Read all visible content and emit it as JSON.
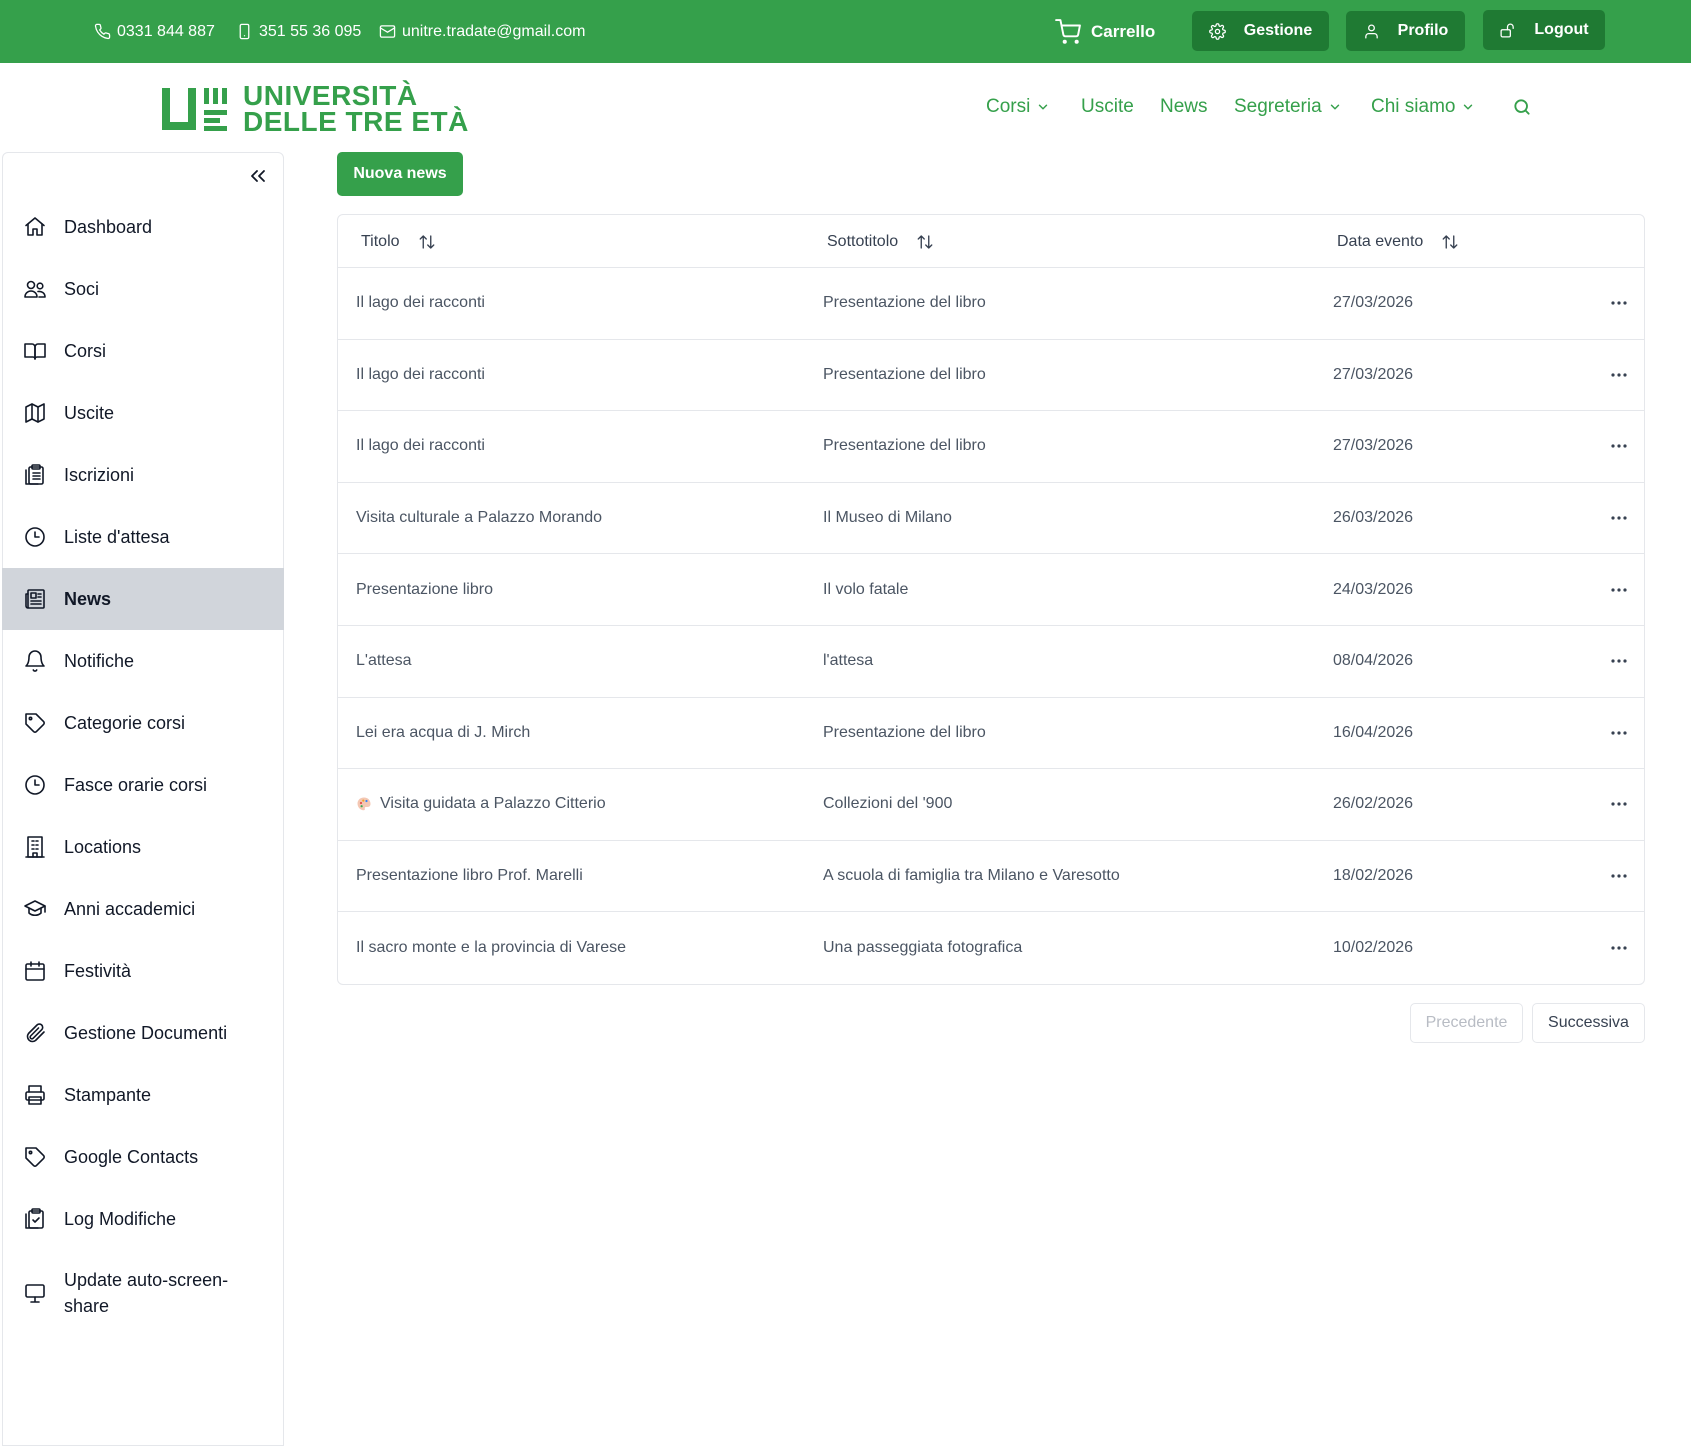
{
  "topbar": {
    "phone": "0331 844 887",
    "mobile": "351 55 36 095",
    "email": "unitre.tradate@gmail.com",
    "cart_label": "Carrello",
    "gestione_label": "Gestione",
    "profilo_label": "Profilo",
    "logout_label": "Logout",
    "bg_color": "#35a04b",
    "button_color": "#1f7a33"
  },
  "header": {
    "logo_line1": "UNIVERSITÀ",
    "logo_line2": "DELLE TRE ETÀ",
    "nav": [
      "Corsi",
      "Uscite",
      "News",
      "Segreteria",
      "Chi siamo"
    ]
  },
  "sidebar": {
    "items": [
      {
        "label": "Dashboard",
        "icon": "home-icon"
      },
      {
        "label": "Soci",
        "icon": "users-icon"
      },
      {
        "label": "Corsi",
        "icon": "book-icon"
      },
      {
        "label": "Uscite",
        "icon": "map-icon"
      },
      {
        "label": "Iscrizioni",
        "icon": "clipboard-list-icon"
      },
      {
        "label": "Liste d'attesa",
        "icon": "clock-icon"
      },
      {
        "label": "News",
        "icon": "newspaper-icon",
        "active": true
      },
      {
        "label": "Notifiche",
        "icon": "bell-icon"
      },
      {
        "label": "Categorie corsi",
        "icon": "tag-icon"
      },
      {
        "label": "Fasce orarie corsi",
        "icon": "clock-icon"
      },
      {
        "label": "Locations",
        "icon": "building-icon"
      },
      {
        "label": "Anni accademici",
        "icon": "graduation-cap-icon"
      },
      {
        "label": "Festività",
        "icon": "calendar-icon"
      },
      {
        "label": "Gestione Documenti",
        "icon": "paperclip-icon"
      },
      {
        "label": "Stampante",
        "icon": "printer-icon"
      },
      {
        "label": "Google Contacts",
        "icon": "tag-icon"
      },
      {
        "label": "Log Modifiche",
        "icon": "clipboard-check-icon"
      },
      {
        "label": "Update auto-screen-share",
        "icon": "monitor-icon"
      }
    ]
  },
  "main": {
    "new_button": "Nuova news",
    "columns": [
      "Titolo",
      "Sottotitolo",
      "Data evento"
    ],
    "rows": [
      {
        "titolo": "Il lago dei racconti",
        "sottotitolo": "Presentazione del libro",
        "data": "27/03/2026"
      },
      {
        "titolo": "Il lago dei racconti",
        "sottotitolo": "Presentazione del libro",
        "data": "27/03/2026"
      },
      {
        "titolo": "Il lago dei racconti",
        "sottotitolo": "Presentazione del libro",
        "data": "27/03/2026"
      },
      {
        "titolo": "Visita culturale a Palazzo Morando",
        "sottotitolo": "Il Museo di Milano",
        "data": "26/03/2026"
      },
      {
        "titolo": "Presentazione libro",
        "sottotitolo": "Il volo fatale",
        "data": "24/03/2026"
      },
      {
        "titolo": "L'attesa",
        "sottotitolo": "l'attesa",
        "data": "08/04/2026"
      },
      {
        "titolo": "Lei era acqua di J. Mirch",
        "sottotitolo": "Presentazione del libro",
        "data": "16/04/2026"
      },
      {
        "titolo": "Visita guidata a Palazzo Citterio",
        "sottotitolo": "Collezioni del '900",
        "data": "26/02/2026",
        "emoji": "palette-icon"
      },
      {
        "titolo": "Presentazione libro Prof. Marelli",
        "sottotitolo": "A scuola di famiglia tra Milano e Varesotto",
        "data": "18/02/2026"
      },
      {
        "titolo": "Il sacro monte e la provincia di Varese",
        "sottotitolo": "Una passeggiata fotografica",
        "data": "10/02/2026"
      }
    ],
    "prev_label": "Precedente",
    "next_label": "Successiva"
  }
}
